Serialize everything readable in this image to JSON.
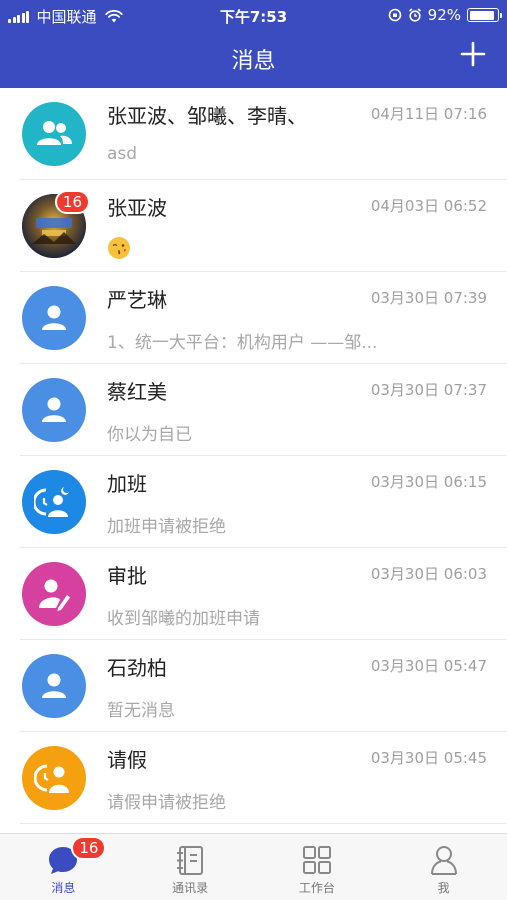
{
  "status_bar": {
    "carrier": "中国联通",
    "time": "下午7:53",
    "battery": "92%",
    "battery_level": 0.92
  },
  "nav": {
    "title": "消息",
    "add_icon": "plus-icon"
  },
  "conversations": [
    {
      "name": "张亚波、邹曦、李晴、",
      "time": "04月11日 07:16",
      "message": "asd",
      "avatar": "group-icon",
      "avatar_color": "#22b5c8"
    },
    {
      "name": "张亚波",
      "time": "04月03日 06:52",
      "message": "",
      "avatar": "photo-avatar",
      "badge": "16",
      "emoji": "kissing-face-emoji"
    },
    {
      "name": "严艺琳",
      "time": "03月30日 07:39",
      "message": "1、统一大平台：机构用户 ——邹...",
      "avatar": "person-icon",
      "avatar_color": "#4a8fe3"
    },
    {
      "name": "蔡红美",
      "time": "03月30日 07:37",
      "message": "你以为自已",
      "avatar": "person-icon",
      "avatar_color": "#4a8fe3"
    },
    {
      "name": "加班",
      "time": "03月30日 06:15",
      "message": "加班申请被拒绝",
      "avatar": "overtime-icon",
      "avatar_color": "#1e88e5"
    },
    {
      "name": "审批",
      "time": "03月30日 06:03",
      "message": "收到邹曦的加班申请",
      "avatar": "approval-icon",
      "avatar_color": "#d6409f"
    },
    {
      "name": "石劲柏",
      "time": "03月30日 05:47",
      "message": "暂无消息",
      "avatar": "person-icon",
      "avatar_color": "#4a8fe3"
    },
    {
      "name": "请假",
      "time": "03月30日 05:45",
      "message": "请假申请被拒绝",
      "avatar": "leave-icon",
      "avatar_color": "#f5a00f"
    }
  ],
  "tabs": [
    {
      "label": "消息",
      "icon": "chat-bubble-icon",
      "badge": "16",
      "active": true
    },
    {
      "label": "通讯录",
      "icon": "contacts-book-icon"
    },
    {
      "label": "工作台",
      "icon": "grid-icon"
    },
    {
      "label": "我",
      "icon": "user-icon"
    }
  ],
  "colors": {
    "primary": "#3a4cbf",
    "badge": "#f03a30"
  }
}
